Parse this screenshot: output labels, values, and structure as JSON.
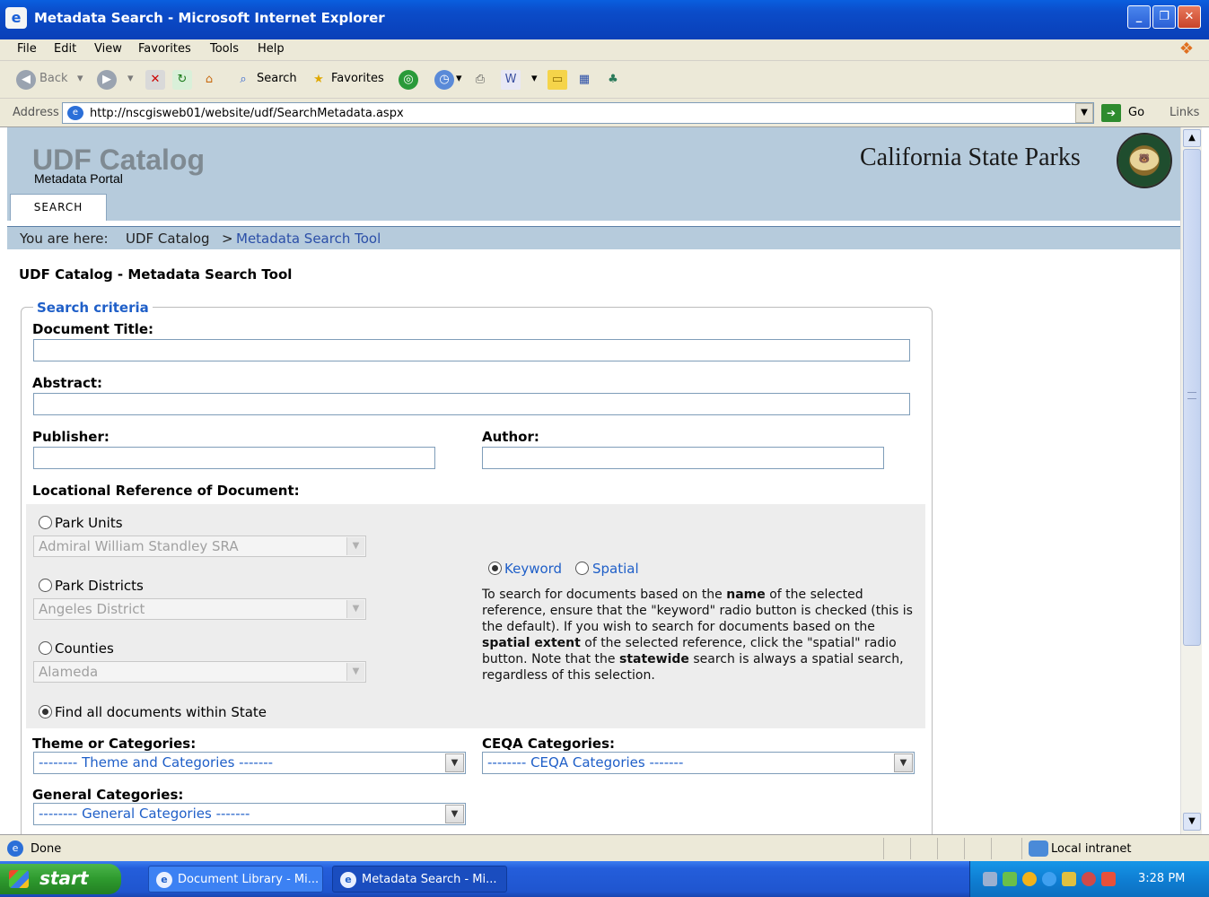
{
  "window": {
    "title": "Metadata Search - Microsoft Internet Explorer",
    "icon": "ie-icon",
    "controls": [
      "minimize",
      "restore",
      "close"
    ]
  },
  "menubar": {
    "items": [
      "File",
      "Edit",
      "View",
      "Favorites",
      "Tools",
      "Help"
    ]
  },
  "toolbar": {
    "back": "Back",
    "search": "Search",
    "favorites": "Favorites"
  },
  "address": {
    "label": "Address",
    "url": "http://nscgisweb01/website/udf/SearchMetadata.aspx",
    "go": "Go",
    "links": "Links"
  },
  "header": {
    "logo_title": "UDF Catalog",
    "logo_subtitle": "Metadata Portal",
    "brand": "California State Parks",
    "tab": "SEARCH"
  },
  "breadcrumb": {
    "prefix": "You are here:",
    "home": "UDF Catalog",
    "separator": ">",
    "current": "Metadata Search Tool"
  },
  "page_title": "UDF Catalog - Metadata Search Tool",
  "form": {
    "legend": "Search criteria",
    "document_title_label": "Document Title:",
    "document_title_value": "",
    "abstract_label": "Abstract:",
    "abstract_value": "",
    "publisher_label": "Publisher:",
    "publisher_value": "",
    "author_label": "Author:",
    "author_value": "",
    "locational_label": "Locational Reference of Document:",
    "park_units": {
      "label": "Park Units",
      "selected": "Admiral William Standley SRA"
    },
    "park_districts": {
      "label": "Park Districts",
      "selected": "Angeles District"
    },
    "counties": {
      "label": "Counties",
      "selected": "Alameda"
    },
    "statewide": {
      "label": "Find all documents within State"
    },
    "search_type": {
      "keyword": "Keyword",
      "spatial": "Spatial"
    },
    "help": {
      "p1": "To search for documents based on the ",
      "b1": "name",
      "p2": " of the selected reference, ensure that the \"keyword\" radio button is checked (this is the default). If you wish to search for documents based on the ",
      "b2": "spatial extent",
      "p3": " of the selected reference, click the \"spatial\" radio button. Note that the ",
      "b3": "statewide",
      "p4": " search is always a spatial search, regardless of this selection."
    },
    "theme_label": "Theme or Categories:",
    "theme_selected": "-------- Theme and Categories -------",
    "ceqa_label": "CEQA Categories:",
    "ceqa_selected": "-------- CEQA Categories -------",
    "general_label": "General Categories:",
    "general_selected": "-------- General Categories -------"
  },
  "status": {
    "text": "Done",
    "zone": "Local intranet"
  },
  "taskbar": {
    "start": "start",
    "tasks": [
      "Document Library - Mi...",
      "Metadata Search - Mi..."
    ],
    "clock": "3:28 PM"
  }
}
